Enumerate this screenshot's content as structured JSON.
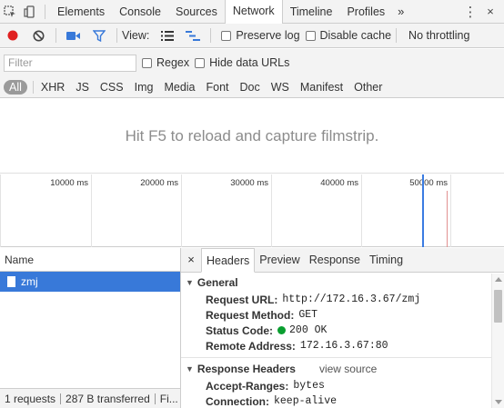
{
  "topbar": {
    "tabs": [
      "Elements",
      "Console",
      "Sources",
      "Network",
      "Timeline",
      "Profiles"
    ],
    "active_tab": "Network",
    "more": "»",
    "menu": "⋮",
    "close": "×"
  },
  "toolbar": {
    "view_label": "View:",
    "preserve_log": "Preserve log",
    "disable_cache": "Disable cache",
    "throttling": "No throttling"
  },
  "filter": {
    "placeholder": "Filter",
    "regex": "Regex",
    "hide_data_urls": "Hide data URLs"
  },
  "types": [
    "All",
    "XHR",
    "JS",
    "CSS",
    "Img",
    "Media",
    "Font",
    "Doc",
    "WS",
    "Manifest",
    "Other"
  ],
  "filmstrip_message": "Hit F5 to reload and capture filmstrip.",
  "overview": {
    "ticks": [
      "10000 ms",
      "20000 ms",
      "30000 ms",
      "40000 ms",
      "50000 ms"
    ]
  },
  "requests": {
    "header": "Name",
    "items": [
      {
        "name": "zmj"
      }
    ]
  },
  "status_bar": {
    "count": "1 requests",
    "transferred": "287 B transferred",
    "finish": "Fi..."
  },
  "detail": {
    "close": "×",
    "tabs": [
      "Headers",
      "Preview",
      "Response",
      "Timing"
    ],
    "active_tab": "Headers",
    "general": {
      "title": "General",
      "request_url_label": "Request URL:",
      "request_url": "http://172.16.3.67/zmj",
      "request_method_label": "Request Method:",
      "request_method": "GET",
      "status_code_label": "Status Code:",
      "status_code": "200 OK",
      "remote_address_label": "Remote Address:",
      "remote_address": "172.16.3.67:80"
    },
    "response_headers": {
      "title": "Response Headers",
      "view_source": "view source",
      "accept_ranges_label": "Accept-Ranges:",
      "accept_ranges": "bytes",
      "connection_label": "Connection:",
      "connection": "keep-alive"
    }
  },
  "colors": {
    "record": "#e02020",
    "accent": "#3879d9",
    "status_ok": "#0a9e30"
  }
}
